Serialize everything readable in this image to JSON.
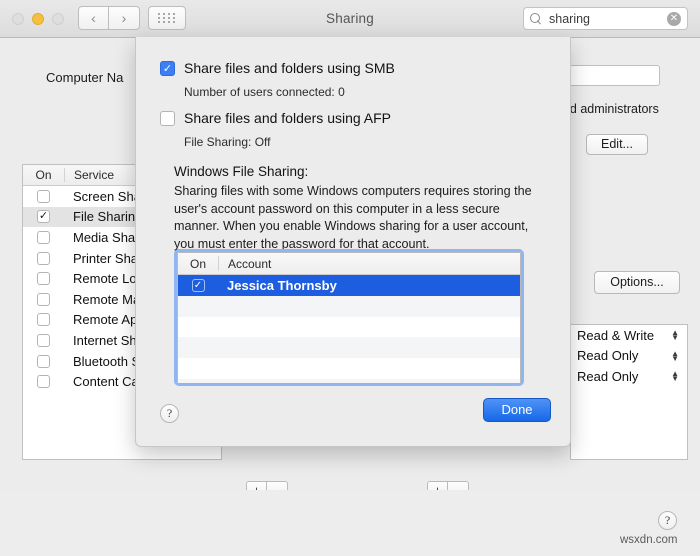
{
  "window": {
    "title": "Sharing",
    "traffic_lights": [
      "close-red-disabled",
      "minimize-yellow",
      "zoom-disabled"
    ],
    "nav": {
      "back": "‹",
      "forward": "›",
      "grid": "grid-icon"
    },
    "search": {
      "value": "sharing",
      "placeholder": "Search",
      "icon": "search-icon",
      "clear": "✕"
    }
  },
  "prefs": {
    "computer_name_label": "Computer Na",
    "computer_name_value": "",
    "edit_button": "Edit...",
    "admins_text": "and administrators",
    "options_button": "Options...",
    "service_table": {
      "headers": {
        "on": "On",
        "service": "Service"
      },
      "rows": [
        {
          "on": false,
          "name": "Screen Sha"
        },
        {
          "on": true,
          "name": "File Sharing"
        },
        {
          "on": false,
          "name": "Media Shar"
        },
        {
          "on": false,
          "name": "Printer Sha"
        },
        {
          "on": false,
          "name": "Remote Log"
        },
        {
          "on": false,
          "name": "Remote Ma"
        },
        {
          "on": false,
          "name": "Remote Ap"
        },
        {
          "on": false,
          "name": "Internet Sh"
        },
        {
          "on": false,
          "name": "Bluetooth S"
        },
        {
          "on": false,
          "name": "Content Ca"
        }
      ]
    },
    "permissions": [
      "Read & Write",
      "Read Only",
      "Read Only"
    ],
    "add_remove": {
      "add": "+",
      "remove": "−"
    },
    "help_button": "?"
  },
  "sheet": {
    "smb": {
      "label": "Share files and folders using SMB",
      "checked": true,
      "check_glyph": "✓"
    },
    "smb_status": "Number of users connected: 0",
    "afp": {
      "label": "Share files and folders using AFP",
      "checked": false
    },
    "afp_status": "File Sharing: Off",
    "windows_title": "Windows File Sharing:",
    "windows_body": "Sharing files with some Windows computers requires storing the user's account password on this computer in a less secure manner. When you enable Windows sharing for a user account, you must enter the password for that account.",
    "account_table": {
      "headers": {
        "on": "On",
        "account": "Account"
      },
      "rows": [
        {
          "on": true,
          "name": "Jessica Thornsby",
          "selected": true
        }
      ],
      "empty_rows": 5
    },
    "help_button": "?",
    "done_button": "Done"
  },
  "watermark": "wsxdn.com",
  "colors": {
    "accent_blue": "#3b7ef5",
    "selection_blue": "#1d5ee0",
    "focus_ring": "#8fb6ef",
    "window_bg": "#ececec",
    "minimize_yellow": "#f6bf3f"
  }
}
